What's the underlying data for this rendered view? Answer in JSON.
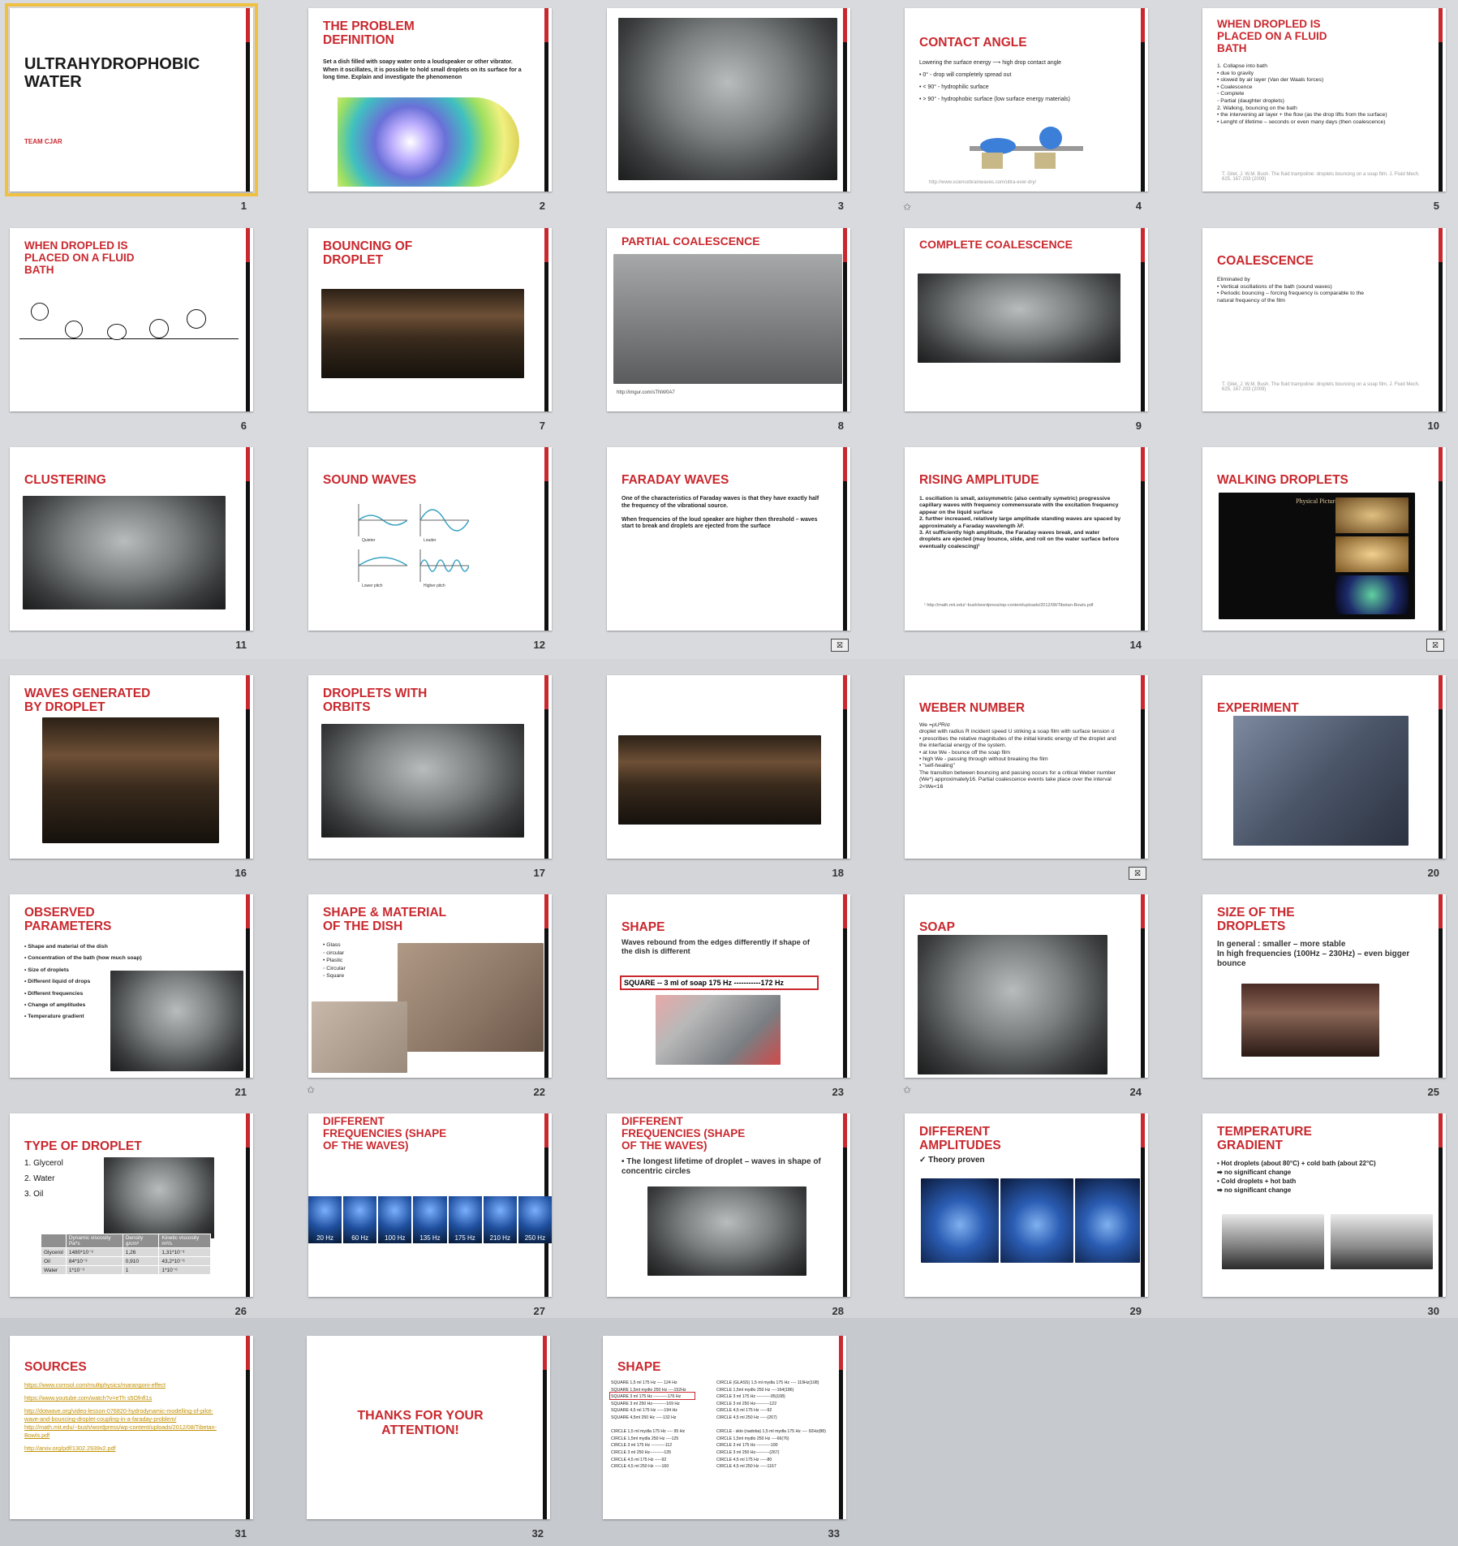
{
  "slides": {
    "s1": {
      "num": "1",
      "title": "ULTRAHYDROPHOBIC\nWATER",
      "subtitle": "TEAM  CJAR"
    },
    "s2": {
      "num": "2",
      "title": "THE PROBLEM\nDEFINITION",
      "body": "Set a dish filled with soapy water onto a loudspeaker or other vibrator. When it oscillates,  it is possible to hold small droplets on its surface for a long time. Explain and investigate the phenomenon"
    },
    "s3": {
      "num": "3"
    },
    "s4": {
      "num": "4",
      "title": "CONTACT ANGLE",
      "body": "Lowering the surface energy  ⟶  high drop contact angle\n•  0° - drop will completely spread out\n•  < 90° - hydrophilic surface\n•  > 90° - hydrophobic surface (low surface energy materials)",
      "ref": "http://www.sciencebrainwaves.com/ultra-ever-dry/"
    },
    "s5": {
      "num": "5",
      "title": "WHEN DROPLED IS\nPLACED ON A FLUID\nBATH",
      "body": "1.  Collapse into bath\n      •  due to gravity\n      •  slowed by air layer (Van der Waals forces)\n      •  Coalescence\n            ◦  Complete\n            ◦  Partial (daughter droplets)\n2.  Walking, bouncing on the bath\n      •  the intervening air layer + the flow (as the drop lifts from the surface)\n      •  Lenght of lifetime – seconds or even many days (then coalescence)",
      "ref": "T. Gilet, J. W.M. Bush. The fluid trampoline: droplets bouncing on a soap film. J. Fluid Mech. 625, 167-203 (2009)"
    },
    "s6": {
      "num": "6",
      "title": "WHEN DROPLED IS\nPLACED ON A FLUID\nBATH"
    },
    "s7": {
      "num": "7",
      "title": "BOUNCING OF\nDROPLET"
    },
    "s8": {
      "num": "8",
      "title": "PARTIAL COALESCENCE",
      "ref": "http://imgur.com/sTNW0A7"
    },
    "s9": {
      "num": "9",
      "title": "COMPLETE COALESCENCE"
    },
    "s10": {
      "num": "10",
      "title": "COALESCENCE",
      "body": "Eliminated by\n   •  Vertical oscillations of the bath (sound waves)\n          •  Periodic bouncing – forcing frequency is comparable to the\n              natural frequency of the film",
      "ref": "T. Gilet, J. W.M. Bush. The fluid trampoline: droplets bouncing on a soap film. J. Fluid Mech. 625, 167-203 (2009)"
    },
    "s11": {
      "num": "11",
      "title": "CLUSTERING"
    },
    "s12": {
      "num": "12",
      "title": "SOUND WAVES",
      "labels": [
        "Quieter",
        "Louder",
        "Lower pitch",
        "Higher pitch"
      ]
    },
    "s13": {
      "title": "FARADAY WAVES",
      "body": "One of the characteristics of Faraday waves is that they have exactly half the frequency of the vibrational source.\n\nWhen frequencies of the loud speaker are higher then threshold – waves start to break and droplets are ejected from the surface"
    },
    "s14": {
      "num": "14",
      "title": "RISING AMPLITUDE",
      "body": "1.   oscillation is small, axisymmetric (also centrally symetric) progressive capillary waves with frequency commensurate with the excitation frequency appear on the liquid surface\n2.   further increased, relatively large amplitude standing waves are spaced by approximately a Faraday wavelength λF.\n3.   At sufficiently high amplitude, the Faraday waves break, and water droplets are ejected (may bounce, slide, and roll on the water surface before eventually coalescing)¹",
      "ref": "¹ http://math.mit.edu/~bush/wordpress/wp-content/uploads/2012/08/Tibetan-Bowls.pdf"
    },
    "s15": {
      "title": "WALKING DROPLETS",
      "caption": "Physical Picture"
    },
    "s16": {
      "num": "16",
      "title": "WAVES GENERATED\nBY DROPLET"
    },
    "s17": {
      "num": "17",
      "title": "DROPLETS WITH\nORBITS"
    },
    "s18": {
      "num": "18"
    },
    "s19": {
      "title": "WEBER NUMBER",
      "body": "We =ρU²R/σ\ndroplet with radius R incident speed U striking a soap film with surface tension σ\n•  prescribes the relative magnitudes of the initial kinetic energy of the droplet and the interfacial energy of the system.\n•  at low We - bounce off the soap film\n•  high We - passing through without breaking the film\n      •  \"self-healing\"\nThe transition between bouncing and passing occurs for a critical Weber number (We*) approximately16.  Partial coalescence events take place over the interval 2<We<16"
    },
    "s20": {
      "num": "20",
      "title": "EXPERIMENT"
    },
    "s21": {
      "num": "21",
      "title": "OBSERVED\nPARAMETERS",
      "body": "•  Shape and material of the dish\n•  Concentration of the bath (how much soap)\n•  Size of droplets\n•  Different liquid of drops\n•  Different frequencies\n•  Change of amplitudes\n•  Temperature gradient"
    },
    "s22": {
      "num": "22",
      "title": "SHAPE & MATERIAL\nOF THE DISH",
      "body": "•  Glass\n      ◦  circular\n•  Plastic\n      ◦  Circular\n      ◦  Square"
    },
    "s23": {
      "num": "23",
      "title": "SHAPE",
      "body": "Waves rebound from the edges differently if shape of the dish is different",
      "box": "SQUARE  -- 3 ml of soap  175 Hz -----------172 Hz"
    },
    "s24": {
      "num": "24",
      "title": "SOAP"
    },
    "s25": {
      "num": "25",
      "title": "SIZE OF THE\nDROPLETS",
      "body": "In general : smaller – more stable\nIn high frequencies (100Hz – 230Hz) – even bigger bounce"
    },
    "s26": {
      "num": "26",
      "title": "TYPE OF DROPLET",
      "body": "1.  Glycerol\n2.  Water\n3.  Oil",
      "table": [
        [
          "",
          "Dynamic viscosity Pa*s",
          "Density g/cm³",
          "Kinetic viscosity m²/s"
        ],
        [
          "Glycerol",
          "1480*10⁻³",
          "1,26",
          "1,31*10⁻³"
        ],
        [
          "Oil",
          "84*10⁻³",
          "0,910",
          "43,2*10⁻⁶"
        ],
        [
          "Water",
          "1*10⁻³",
          "1",
          "1*10⁻⁶"
        ]
      ]
    },
    "s27": {
      "num": "27",
      "title": "DIFFERENT\nFREQUENCIES (SHAPE\nOF THE WAVES)",
      "freqs": [
        "20 Hz",
        "60 Hz",
        "100 Hz",
        "135 Hz",
        "175 Hz",
        "210 Hz",
        "250 Hz"
      ]
    },
    "s28": {
      "num": "28",
      "title": "DIFFERENT\nFREQUENCIES (SHAPE\nOF THE WAVES)",
      "body": "•  The longest lifetime of droplet – waves in shape of concentric circles"
    },
    "s29": {
      "num": "29",
      "title": "DIFFERENT\nAMPLITUDES",
      "body": "✓  Theory proven"
    },
    "s30": {
      "num": "30",
      "title": "TEMPERATURE\nGRADIENT",
      "body": "•  Hot droplets (about 80°C) + cold bath (about 22°C)\n                 ➡  no significant change\n•  Cold droplets + hot bath\n                 ➡  no significant change"
    },
    "s31": {
      "num": "31",
      "title": "SOURCES",
      "links": [
        "https://www.comsol.com/multiphysics/marangoni-effect",
        "https://www.youtube.com/watch?v=eTh s5Ofnfl1s",
        "http://dotwave.org/video-lesson-076820-hydrodynamic-modelling-of-pilot-wave-and-bouncing-droplet-coupling-in-a-faraday-problem/    http://math.mit.edu/~bush/wordpress/wp-content/uploads/2012/08/Tibetan-Bowls.pdf",
        "http://arxiv.org/pdf/1302.2939v2.pdf"
      ]
    },
    "s32": {
      "num": "32",
      "title": "THANKS FOR YOUR\nATTENTION!"
    },
    "s33": {
      "num": "33",
      "title": "SHAPE",
      "col1": "SQUARE 1,5 ml  175 Hz ---- 124 Hz\nSQUARE 1,5ml mydlo 250 Hz ----152Hz\nSQUARE 3 ml 175 Hz ----------176 Hz\nSQUARE 3 ml 250 Hz----------169 Hz\nSQUARE 4,5 ml 175 Hz -----194 Hz\nSQUARE 4,5ml 250 Hz -----132 Hz\n\nCIRCLE 1,5 ml mydla 175 Hz ---- 95 Hz\nCIRCLE 1,5ml mydla 250 Hz ----125\nCIRCLE 3 ml 175 Hz ----------112\nCIRCLE 3 ml 250 Hz----------135\nCIRCLE 4,5 ml 175 Hz -----92\nCIRCLE 4,5 ml 250 Hz -----160",
      "col2": "CIRCLE (GLASS) 1,5 ml mydla 175 Hz ---- 119Hz(108)\nCIRCLE 1,5ml mydlo 250 Hz ----164(186)\nCIRCLE 3 ml 175 Hz ----------95(108)\nCIRCLE 3 ml 250 Hz----------122\nCIRCLE 4,5 ml 175 Hz -----92\nCIRCLE 4,5 ml 250 Hz -----(267)\n\nCIRCLE - sklo (nadoba) 1,5 ml mydla 175 Hz ---- 92Hz(88)\nCIRCLE 1,5ml mydlo 250 Hz ----66(76)\nCIRCLE 3 ml 175 Hz ----------100\nCIRCLE 3 ml 250 Hz----------(267)\nCIRCLE 4,5 ml 175 Hz -----80\nCIRCLE 4,5 ml 250 Hz -----1167"
    }
  }
}
